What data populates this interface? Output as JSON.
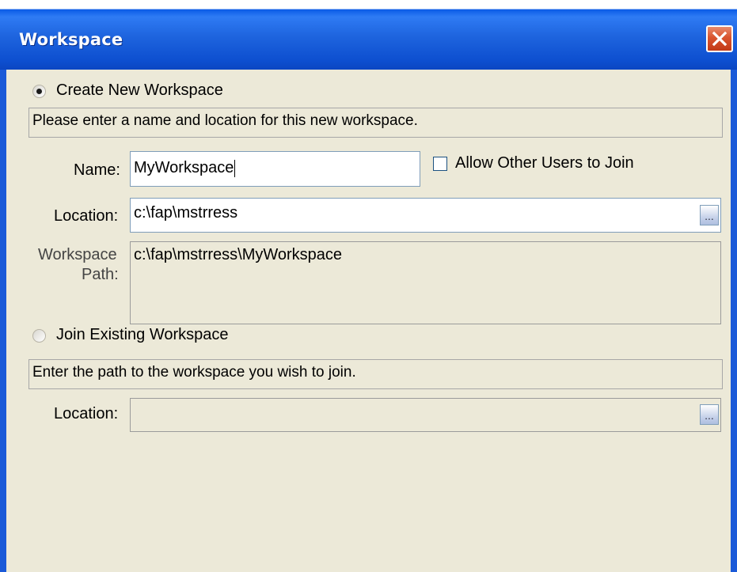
{
  "window": {
    "title": "Workspace",
    "close_symbol": "✕",
    "close_icon": "close-icon"
  },
  "create": {
    "radio_label": "Create New Workspace",
    "radio_selected": true,
    "description": "Please enter a name and location for this new workspace.",
    "name_label": "Name:",
    "name_value": "MyWorkspace",
    "allow_label": "Allow Other Users to Join",
    "allow_checked": false,
    "location_label": "Location:",
    "location_value": "c:\\fap\\mstrress",
    "browse_label": "...",
    "path_label_line1": "Workspace",
    "path_label_line2": "Path:",
    "path_value": "c:\\fap\\mstrress\\MyWorkspace"
  },
  "join": {
    "radio_label": "Join Existing Workspace",
    "radio_selected": false,
    "description": "Enter the path to the workspace you wish to join.",
    "location_label": "Location:",
    "location_value": "",
    "browse_label": "..."
  }
}
